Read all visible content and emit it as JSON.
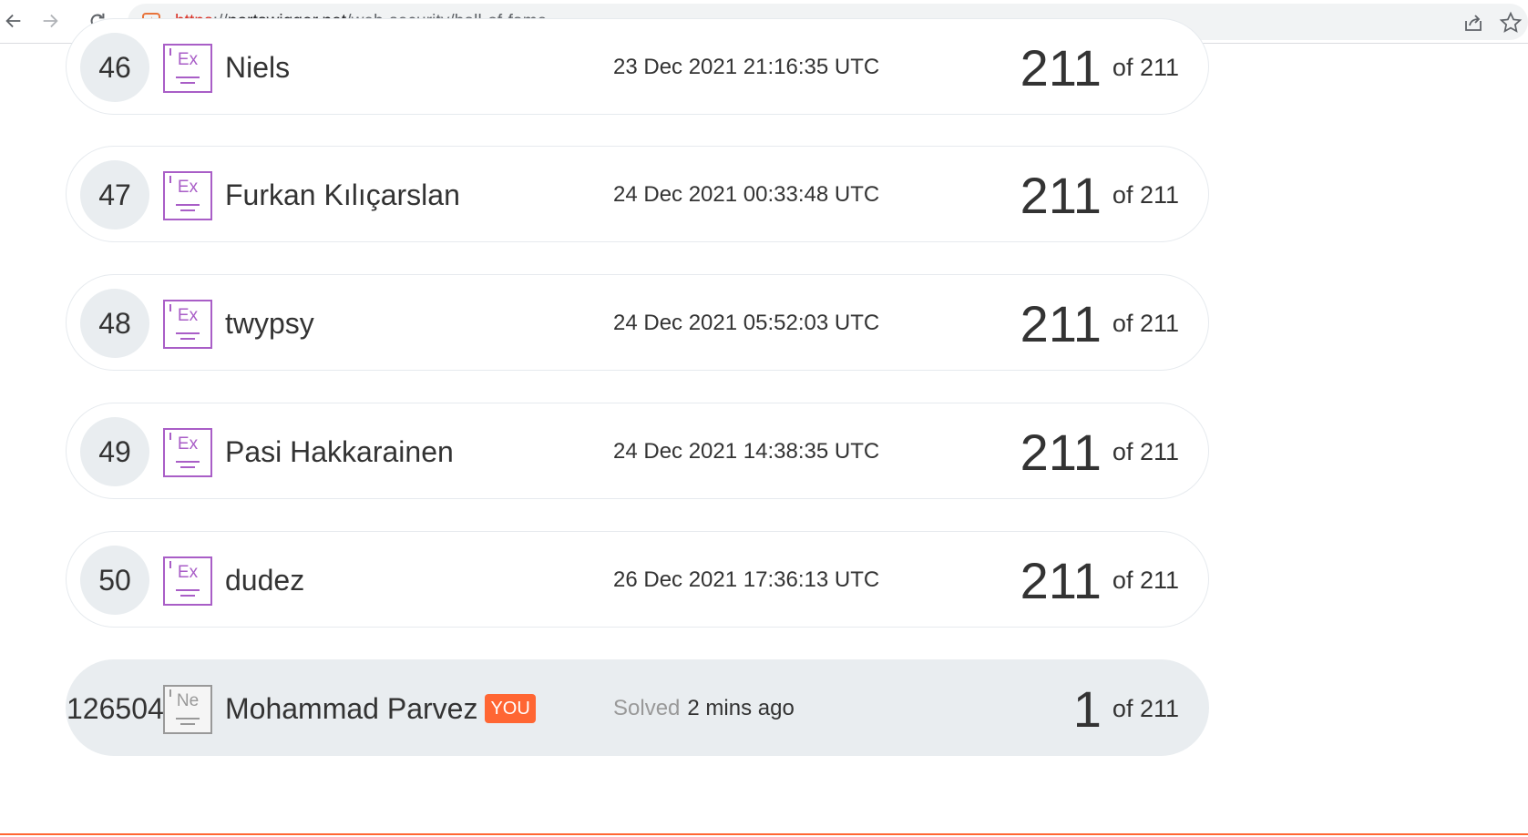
{
  "browser": {
    "url_scheme": "https",
    "url_separator": "://",
    "url_host": "portswigger.net",
    "url_path": "/web-security/hall-of-fame"
  },
  "leaderboard": [
    {
      "rank": "46",
      "badge": "Ex",
      "name": "Niels",
      "date": "23 Dec 2021 21:16:35 UTC",
      "score": "211",
      "of": "of 211"
    },
    {
      "rank": "47",
      "badge": "Ex",
      "name": "Furkan Kılıçarslan",
      "date": "24 Dec 2021 00:33:48 UTC",
      "score": "211",
      "of": "of 211"
    },
    {
      "rank": "48",
      "badge": "Ex",
      "name": "twypsy",
      "date": "24 Dec 2021 05:52:03 UTC",
      "score": "211",
      "of": "of 211"
    },
    {
      "rank": "49",
      "badge": "Ex",
      "name": "Pasi Hakkarainen",
      "date": "24 Dec 2021 14:38:35 UTC",
      "score": "211",
      "of": "of 211"
    },
    {
      "rank": "50",
      "badge": "Ex",
      "name": "dudez",
      "date": "26 Dec 2021 17:36:13 UTC",
      "score": "211",
      "of": "of 211"
    }
  ],
  "current_user": {
    "rank": "126504",
    "badge": "Ne",
    "name": "Mohammad Parvez",
    "you_label": "YOU",
    "solved_label": "Solved",
    "solved_time": "2 mins ago",
    "score": "1",
    "of": "of 211"
  },
  "colors": {
    "accent": "#ff6633",
    "expert_badge": "#a95ec7",
    "novice_badge": "#999999",
    "row_highlight": "#e9edf0"
  }
}
